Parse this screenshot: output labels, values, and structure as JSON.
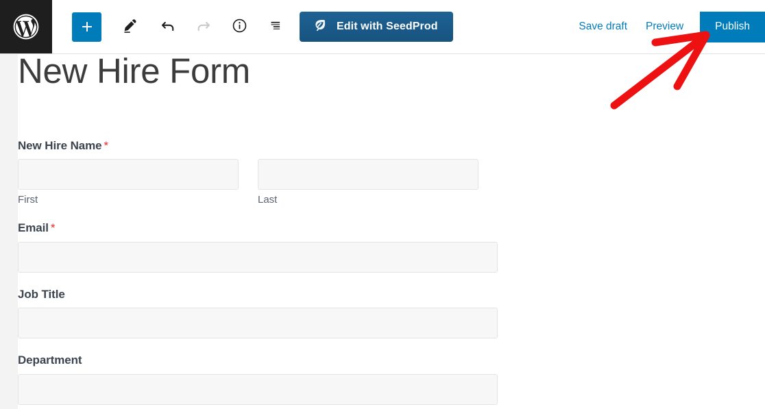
{
  "header": {
    "logo_icon": "wordpress-logo-icon",
    "tools": [
      {
        "name": "add-block-button",
        "icon": "plus-icon",
        "label": "Add block",
        "state": "primary"
      },
      {
        "name": "tools-pencil-button",
        "icon": "pencil-icon",
        "label": "Tools",
        "state": "enabled"
      },
      {
        "name": "undo-button",
        "icon": "undo-arrow-icon",
        "label": "Undo",
        "state": "enabled"
      },
      {
        "name": "redo-button",
        "icon": "redo-arrow-icon",
        "label": "Redo",
        "state": "disabled"
      },
      {
        "name": "details-button",
        "icon": "info-circle-icon",
        "label": "Details",
        "state": "enabled"
      },
      {
        "name": "list-view-button",
        "icon": "list-view-icon",
        "label": "List view",
        "state": "enabled"
      }
    ],
    "seedprod": {
      "label": "Edit with SeedProd",
      "icon": "seedprod-leaf-icon",
      "bg_color": "#1a5a8a"
    },
    "save_draft_label": "Save draft",
    "preview_label": "Preview",
    "publish_label": "Publish",
    "accent_color": "#007cba",
    "link_color": "#007cba",
    "logo_bg_color": "#1e1e1e"
  },
  "content": {
    "post_title": "New Hire Form",
    "fields": [
      {
        "name": "new-hire-name",
        "label": "New Hire Name",
        "required": true,
        "required_marker": "*",
        "type": "name",
        "subfields": [
          {
            "name": "first-name",
            "sub_label": "First",
            "value": "",
            "placeholder": ""
          },
          {
            "name": "last-name",
            "sub_label": "Last",
            "value": "",
            "placeholder": ""
          }
        ]
      },
      {
        "name": "email",
        "label": "Email",
        "required": true,
        "required_marker": "*",
        "type": "text",
        "value": "",
        "placeholder": ""
      },
      {
        "name": "job-title",
        "label": "Job Title",
        "required": false,
        "required_marker": "",
        "type": "text",
        "value": "",
        "placeholder": ""
      },
      {
        "name": "department",
        "label": "Department",
        "required": false,
        "required_marker": "",
        "type": "text",
        "value": "",
        "placeholder": ""
      }
    ],
    "required_color": "#e8262c",
    "label_color": "#3b444f",
    "input_bg_color": "#f7f7f7"
  },
  "annotation": {
    "type": "arrow",
    "color": "#ee1111",
    "points_to": "publish-button",
    "description": "Red hand-drawn arrow pointing up-right toward the Publish button"
  }
}
